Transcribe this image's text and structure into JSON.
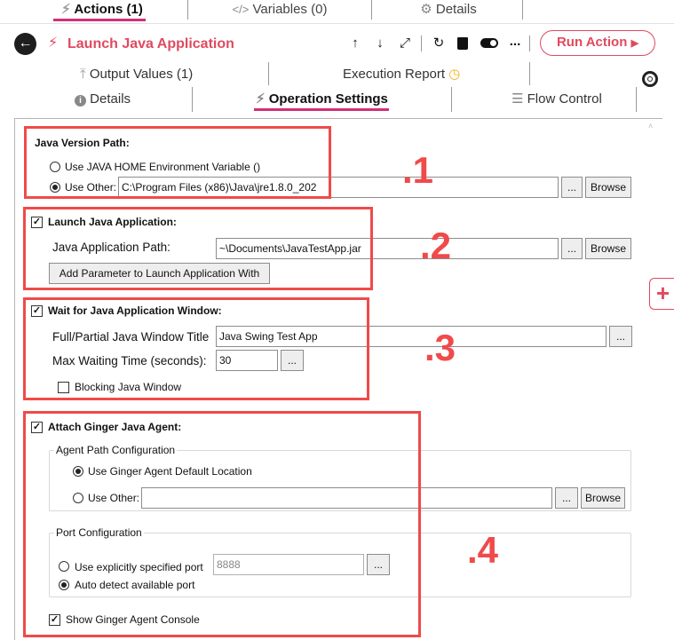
{
  "top_tabs": [
    {
      "label": "Actions (1)"
    },
    {
      "label": "Variables (0)"
    },
    {
      "label": "Details"
    }
  ],
  "header": {
    "title": "Launch Java Application",
    "run_label": "Run Action",
    "more_label": "..."
  },
  "sub_tabs": {
    "output_values": "Output Values (1)",
    "execution_report": "Execution Report",
    "details": "Details",
    "operation_settings": "Operation Settings",
    "flow_control": "Flow Control"
  },
  "section1": {
    "title": "Java Version Path:",
    "opt_home": "Use JAVA HOME Environment Variable ()",
    "opt_other": "Use Other:",
    "other_value": "C:\\Program Files (x86)\\Java\\jre1.8.0_202",
    "browse": "Browse",
    "ellipsis": "...",
    "marker": ".1"
  },
  "section2": {
    "title": "Launch Java Application:",
    "path_label": "Java Application Path:",
    "path_value": "~\\Documents\\JavaTestApp.jar",
    "ellipsis": "...",
    "browse": "Browse",
    "add_param": "Add Parameter to Launch Application With",
    "marker": ".2"
  },
  "section3": {
    "title": "Wait for Java Application Window:",
    "window_title_label": "Full/Partial Java Window Title",
    "window_title_value": "Java Swing Test App",
    "wait_label": "Max Waiting Time (seconds):",
    "wait_value": "30",
    "ellipsis": "...",
    "blocking": "Blocking Java Window",
    "marker": ".3"
  },
  "section4": {
    "title": "Attach Ginger Java Agent:",
    "agent_group": "Agent Path Configuration",
    "opt_default": "Use Ginger Agent Default Location",
    "opt_other": "Use Other:",
    "ellipsis": "...",
    "browse": "Browse",
    "port_group": "Port Configuration",
    "opt_port": "Use explicitly specified port",
    "port_value": "8888",
    "opt_auto": "Auto detect available port",
    "show_console": "Show Ginger Agent Console",
    "marker": ".4"
  },
  "colors": {
    "accent": "#e04a5f",
    "underline": "#d0307a",
    "marker_red": "#f04a4a"
  }
}
